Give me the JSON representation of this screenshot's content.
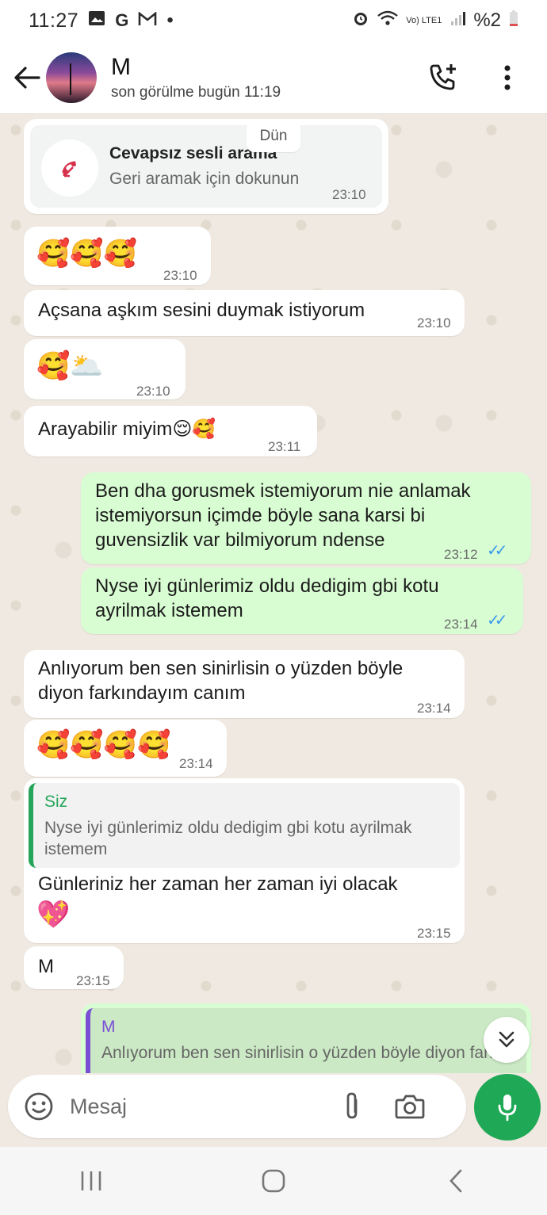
{
  "status_bar": {
    "time": "11:27",
    "notif_icons": [
      "gallery-icon",
      "google-icon",
      "gmail-icon"
    ],
    "dot": "•",
    "network": "Vo) LTE1",
    "battery": "%2"
  },
  "header": {
    "contact_name": "M",
    "last_seen": "son görülme bugün 11:19"
  },
  "messages": {
    "day_chip": "Dün",
    "missed_call": {
      "title": "Cevapsız sesli arama",
      "subtitle": "Geri aramak için dokunun",
      "time": "23:10"
    },
    "m1": {
      "emoji": "🥰🥰🥰",
      "time": "23:10"
    },
    "m2": {
      "text": "Açsana aşkım sesini duymak istiyorum",
      "time": "23:10"
    },
    "m3": {
      "emoji": "🥰🌥️",
      "time": "23:10"
    },
    "m4": {
      "text": "Arayabilir miyim😌🥰",
      "time": "23:11"
    },
    "m5": {
      "text": "Ben dha gorusmek istemiyorum nie anlamak istemiyorsun içimde böyle sana karsi bi guvensizlik var bilmiyorum ndense",
      "time": "23:12",
      "ticks": "✓✓"
    },
    "m6": {
      "text": "Nyse iyi günlerimiz oldu dedigim gbi kotu ayrilmak istemem",
      "time": "23:14",
      "ticks": "✓✓"
    },
    "m7": {
      "text": "Anlıyorum ben sen sinirlisin o yüzden böyle diyon farkındayım canım",
      "time": "23:14"
    },
    "m8": {
      "emoji": "🥰🥰🥰🥰",
      "time": "23:14"
    },
    "m9": {
      "quote_name": "Siz",
      "quote_text": "Nyse iyi günlerimiz oldu dedigim gbi kotu ayrilmak istemem",
      "text": "Günleriniz her zaman her zaman iyi olacak",
      "emoji": "💖",
      "time": "23:15"
    },
    "m10": {
      "text": "M",
      "time": "23:15"
    },
    "m11": {
      "quote_name": "M",
      "quote_text": "Anlıyorum ben sen sinirlisin o yüzden böyle diyon farkındayım"
    }
  },
  "input": {
    "placeholder": "Mesaj"
  },
  "colors": {
    "outgoing": "#d9fdd3",
    "incoming": "#ffffff",
    "accent": "#1fa855",
    "tick": "#3a9be8"
  }
}
